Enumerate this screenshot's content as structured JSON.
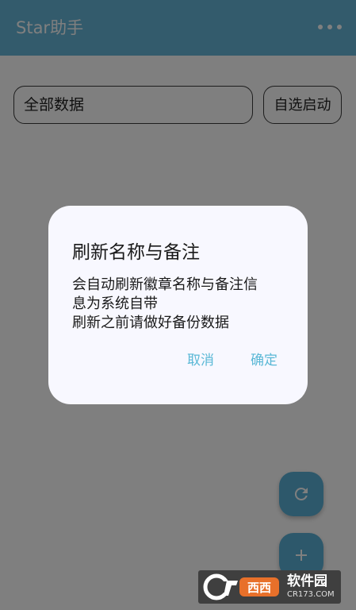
{
  "app_bar": {
    "title": "Star助手",
    "color": "#67b7d8"
  },
  "filter": {
    "selected": "全部数据",
    "auto_start_label": "自选启动"
  },
  "fabs": {
    "refresh_icon": "refresh-icon",
    "add_icon": "plus-icon",
    "color": "#5ab0d6"
  },
  "dialog": {
    "title": "刷新名称与备注",
    "body_lines": [
      "会自动刷新徽章名称与备注信",
      "息为系统自带",
      "刷新之前请做好备份数据"
    ],
    "cancel_label": "取消",
    "confirm_label": "确定",
    "button_color": "#5ab8d6"
  },
  "watermark": {
    "logo_text": "西西",
    "site_name": "软件园",
    "url": "CR173.COM"
  }
}
